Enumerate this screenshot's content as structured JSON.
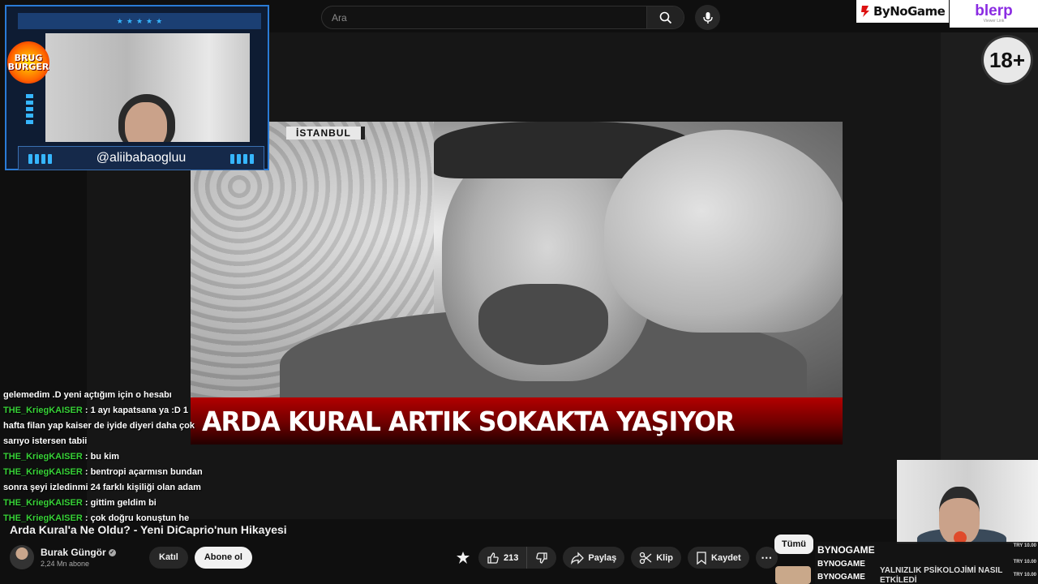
{
  "search": {
    "placeholder": "Ara"
  },
  "sponsors": {
    "bynogame": "ByNoGame",
    "blerp": "blerp",
    "blerp_sub": "Viewer Link"
  },
  "age_badge": "18+",
  "facecam": {
    "username": "@aliibabaogluu",
    "logo_line1": "BRUG",
    "logo_line2": "BURGER"
  },
  "video": {
    "location_tag": "İSTANBUL",
    "headline": "ARDA KURAL ARTIK SOKAKTA YAŞIYOR",
    "title": "Arda Kural'a Ne Oldu? - Yeni DiCaprio'nun Hikayesi"
  },
  "channel": {
    "name": "Burak Güngör",
    "subscribers": "2,24 Mn abone",
    "join_label": "Katıl",
    "subscribe_label": "Abone ol"
  },
  "actions": {
    "likes": "213",
    "share_label": "Paylaş",
    "clip_label": "Klip",
    "save_label": "Kaydet"
  },
  "chat": [
    {
      "user": "",
      "message": "gelemedim .D yeni açtığım için o hesabı"
    },
    {
      "user": "THE_KriegKAISER",
      "message": ": 1 ayı kapatsana ya :D 1 hafta filan yap kaiser de iyide diyeri daha çok sarıyo istersen tabii"
    },
    {
      "user": "THE_KriegKAISER",
      "message": ": bu kim"
    },
    {
      "user": "THE_KriegKAISER",
      "message": ": bentropi açarmısn bundan sonra şeyi izledinmi 24 farklı kişiliği olan adam"
    },
    {
      "user": "THE_KriegKAISER",
      "message": ": gittim geldim bi"
    },
    {
      "user": "THE_KriegKAISER",
      "message": ": çok doğru konuştun he"
    }
  ],
  "filter_chip": "Tümü",
  "ticker": {
    "rows": [
      {
        "name": "BYNOGAME",
        "price": "TRY 10.00"
      },
      {
        "name": "BYNOGAME",
        "price": "TRY 10.00"
      },
      {
        "name": "BYNOGAME",
        "price": "TRY 10.00"
      }
    ],
    "message": "YALNIZLIK PSİKOLOJİMİ NASIL ETKİLEDİ"
  },
  "icons": {
    "search": "search-icon",
    "mic": "mic-icon",
    "like": "thumbs-up-icon",
    "dislike": "thumbs-down-icon",
    "share": "share-icon",
    "clip": "scissors-icon",
    "save": "bookmark-icon",
    "more": "more-icon",
    "gift": "gift-icon"
  }
}
